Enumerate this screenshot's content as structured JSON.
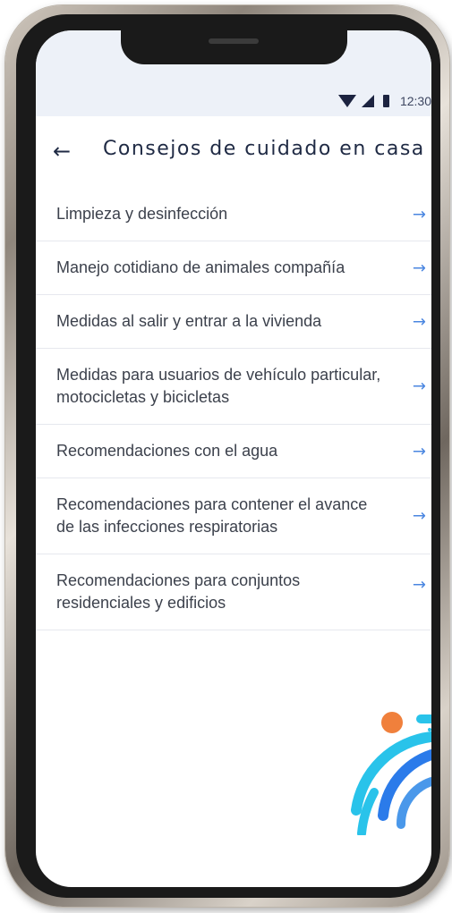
{
  "status_bar": {
    "time": "12:30",
    "icons": [
      "wifi-icon",
      "signal-icon",
      "battery-icon"
    ]
  },
  "header": {
    "back_icon": "arrow-left-icon",
    "title": "Consejos de cuidado en casa"
  },
  "menu": {
    "items": [
      {
        "label": "Limpieza y desinfección"
      },
      {
        "label": "Manejo cotidiano de animales compañía"
      },
      {
        "label": "Medidas al salir y entrar a la vivienda"
      },
      {
        "label": "Medidas para usuarios de vehículo particular, motocicletas y bicicletas"
      },
      {
        "label": "Recomendaciones con el agua"
      },
      {
        "label": "Recomendaciones para contener el avance de las infecciones respiratorias"
      },
      {
        "label": "Recomendaciones para conjuntos residenciales y edificios"
      }
    ],
    "item_arrow_icon": "arrow-right-icon"
  },
  "colors": {
    "title": "#1f2a44",
    "item_text": "#3c414c",
    "arrow_accent": "#4a86e0",
    "status_bg": "#edf1f8",
    "logo_orange": "#f0803c",
    "logo_light_blue": "#29c3ea",
    "logo_blue": "#2b7bea"
  }
}
